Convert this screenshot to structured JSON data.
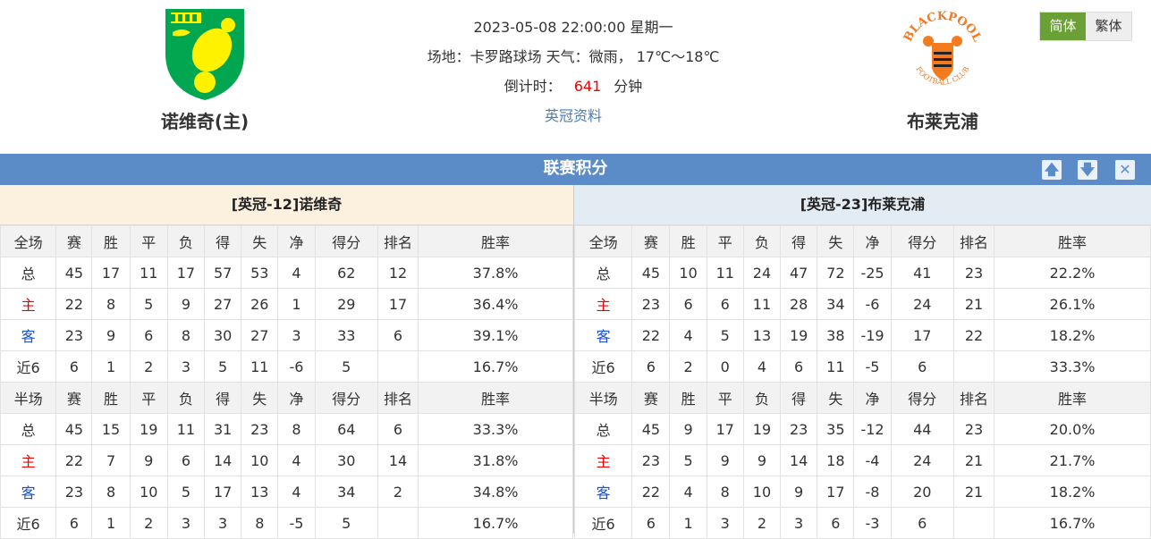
{
  "header": {
    "home_team": "诺维奇(主)",
    "away_team": "布莱克浦",
    "datetime": "2023-05-08 22:00:00 星期一",
    "venue_weather": "场地：卡罗路球场 天气：微雨， 17℃～18℃",
    "countdown_label": "倒计时：",
    "countdown_value": "641",
    "countdown_unit": "分钟",
    "league_link": "英冠资料",
    "away_logo_text": "BLACKPOOL",
    "away_logo_subtext": "FOOTBALL CLUB"
  },
  "lang": {
    "simplified": "简体",
    "traditional": "繁体"
  },
  "section": {
    "title": "联赛积分"
  },
  "colors": {
    "bar": "#5b8cc7",
    "lang_active": "#6aa036",
    "home_label": "#e00000",
    "away_label": "#1a4fd6"
  },
  "home_table": {
    "caption": "[英冠-12]诺维奇",
    "full": {
      "header": [
        "全场",
        "赛",
        "胜",
        "平",
        "负",
        "得",
        "失",
        "净",
        "得分",
        "排名",
        "胜率"
      ],
      "rows": [
        [
          "总",
          "45",
          "17",
          "11",
          "17",
          "57",
          "53",
          "4",
          "62",
          "12",
          "37.8%"
        ],
        [
          "主",
          "22",
          "8",
          "5",
          "9",
          "27",
          "26",
          "1",
          "29",
          "17",
          "36.4%"
        ],
        [
          "客",
          "23",
          "9",
          "6",
          "8",
          "30",
          "27",
          "3",
          "33",
          "6",
          "39.1%"
        ],
        [
          "近6",
          "6",
          "1",
          "2",
          "3",
          "5",
          "11",
          "-6",
          "5",
          "",
          "16.7%"
        ]
      ]
    },
    "half": {
      "header": [
        "半场",
        "赛",
        "胜",
        "平",
        "负",
        "得",
        "失",
        "净",
        "得分",
        "排名",
        "胜率"
      ],
      "rows": [
        [
          "总",
          "45",
          "15",
          "19",
          "11",
          "31",
          "23",
          "8",
          "64",
          "6",
          "33.3%"
        ],
        [
          "主",
          "22",
          "7",
          "9",
          "6",
          "14",
          "10",
          "4",
          "30",
          "14",
          "31.8%"
        ],
        [
          "客",
          "23",
          "8",
          "10",
          "5",
          "17",
          "13",
          "4",
          "34",
          "2",
          "34.8%"
        ],
        [
          "近6",
          "6",
          "1",
          "2",
          "3",
          "3",
          "8",
          "-5",
          "5",
          "",
          "16.7%"
        ]
      ]
    }
  },
  "away_table": {
    "caption": "[英冠-23]布莱克浦",
    "full": {
      "header": [
        "全场",
        "赛",
        "胜",
        "平",
        "负",
        "得",
        "失",
        "净",
        "得分",
        "排名",
        "胜率"
      ],
      "rows": [
        [
          "总",
          "45",
          "10",
          "11",
          "24",
          "47",
          "72",
          "-25",
          "41",
          "23",
          "22.2%"
        ],
        [
          "主",
          "23",
          "6",
          "6",
          "11",
          "28",
          "34",
          "-6",
          "24",
          "21",
          "26.1%"
        ],
        [
          "客",
          "22",
          "4",
          "5",
          "13",
          "19",
          "38",
          "-19",
          "17",
          "22",
          "18.2%"
        ],
        [
          "近6",
          "6",
          "2",
          "0",
          "4",
          "6",
          "11",
          "-5",
          "6",
          "",
          "33.3%"
        ]
      ]
    },
    "half": {
      "header": [
        "半场",
        "赛",
        "胜",
        "平",
        "负",
        "得",
        "失",
        "净",
        "得分",
        "排名",
        "胜率"
      ],
      "rows": [
        [
          "总",
          "45",
          "9",
          "17",
          "19",
          "23",
          "35",
          "-12",
          "44",
          "23",
          "20.0%"
        ],
        [
          "主",
          "23",
          "5",
          "9",
          "9",
          "14",
          "18",
          "-4",
          "24",
          "21",
          "21.7%"
        ],
        [
          "客",
          "22",
          "4",
          "8",
          "10",
          "9",
          "17",
          "-8",
          "20",
          "21",
          "18.2%"
        ],
        [
          "近6",
          "6",
          "1",
          "3",
          "2",
          "3",
          "6",
          "-3",
          "6",
          "",
          "16.7%"
        ]
      ]
    }
  }
}
